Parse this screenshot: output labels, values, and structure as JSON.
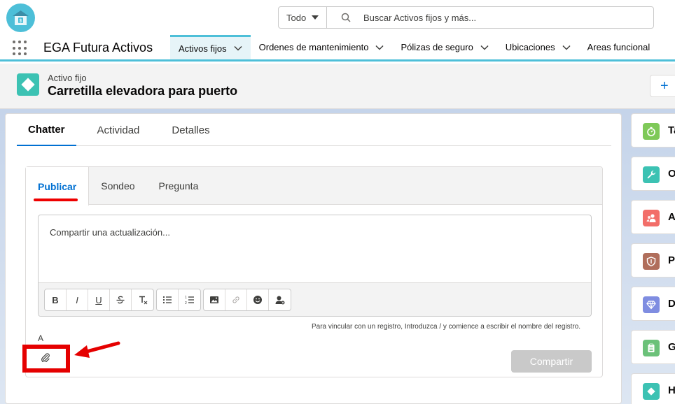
{
  "header": {
    "search_scope": "Todo",
    "search_placeholder": "Buscar Activos fijos y más..."
  },
  "nav": {
    "app_name": "EGA Futura Activos",
    "items": [
      {
        "label": "Activos fijos"
      },
      {
        "label": "Ordenes de mantenimiento"
      },
      {
        "label": "Pólizas de seguro"
      },
      {
        "label": "Ubicaciones"
      },
      {
        "label": "Areas funcional"
      }
    ]
  },
  "record": {
    "type": "Activo fijo",
    "title": "Carretilla elevadora para puerto",
    "plus": "+"
  },
  "tabs": [
    {
      "label": "Chatter"
    },
    {
      "label": "Actividad"
    },
    {
      "label": "Detalles"
    }
  ],
  "publisher": {
    "tabs": [
      {
        "label": "Publicar"
      },
      {
        "label": "Sondeo"
      },
      {
        "label": "Pregunta"
      }
    ],
    "placeholder": "Compartir una actualización...",
    "hint": "Para vincular con un registro, Introduzca / y comience a escribir el nombre del registro.",
    "audience_label": "A",
    "share_label": "Compartir",
    "toolbar": {
      "bold": "B",
      "italic": "I",
      "underline": "U"
    }
  },
  "sidebar": [
    {
      "label": "Ta",
      "color": "#7ec958"
    },
    {
      "label": "O",
      "color": "#3cc2b3"
    },
    {
      "label": "A",
      "color": "#f26e69"
    },
    {
      "label": "P",
      "color": "#b06e5b"
    },
    {
      "label": "D",
      "color": "#7f8de1"
    },
    {
      "label": "G",
      "color": "#6bc179"
    },
    {
      "label": "H",
      "color": "#3cc2b3"
    }
  ],
  "colors": {
    "brand": "#4dbfd8",
    "link": "#0070d2",
    "highlight": "#e50000"
  }
}
